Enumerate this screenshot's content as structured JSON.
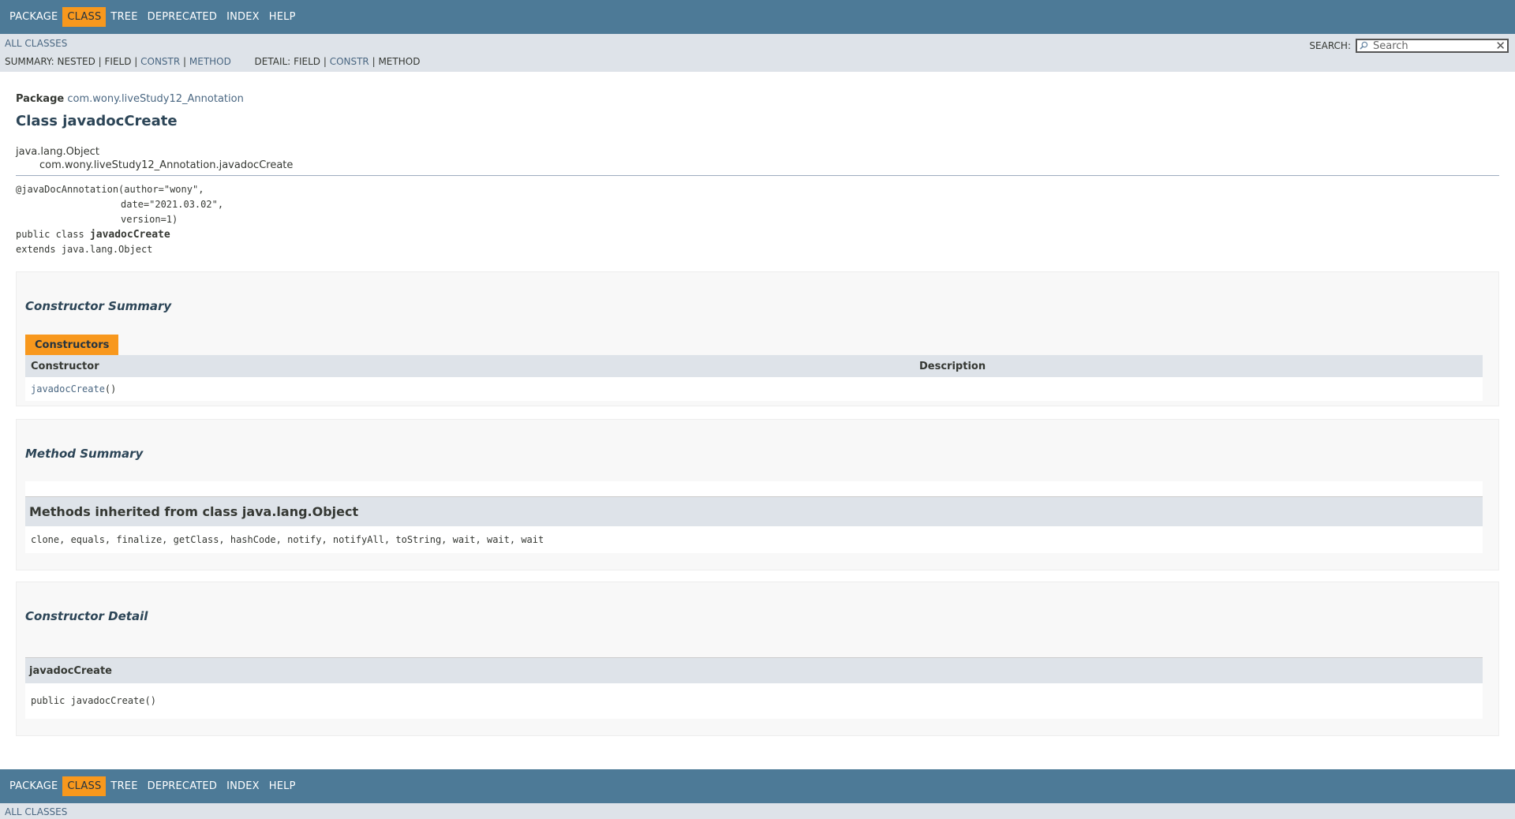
{
  "nav": {
    "items": [
      "PACKAGE",
      "CLASS",
      "TREE",
      "DEPRECATED",
      "INDEX",
      "HELP"
    ],
    "active": "CLASS"
  },
  "subnav": {
    "all_classes": "ALL CLASSES",
    "summary_label": "SUMMARY:",
    "summary_nested": "NESTED",
    "summary_field": "FIELD",
    "summary_constr": "CONSTR",
    "summary_method": "METHOD",
    "detail_label": "DETAIL:",
    "detail_field": "FIELD",
    "detail_constr": "CONSTR",
    "detail_method": "METHOD",
    "separator": " | ",
    "search_label": "SEARCH:",
    "search_placeholder": "Search"
  },
  "header": {
    "package_label": "Package",
    "package_name": "com.wony.liveStudy12_Annotation",
    "class_title": "Class javadocCreate"
  },
  "inheritance": {
    "parent": "java.lang.Object",
    "child": "com.wony.liveStudy12_Annotation.javadocCreate"
  },
  "signature": {
    "annotation_line1": "@javaDocAnnotation(author=\"wony\",",
    "annotation_line2": "date=\"2021.03.02\",",
    "annotation_line3": "version=1)",
    "decl_prefix": "public class ",
    "class_name": "javadocCreate",
    "extends_line": "extends java.lang.Object"
  },
  "constructor_summary": {
    "heading": "Constructor Summary",
    "tab": "Constructors",
    "col_constructor": "Constructor",
    "col_description": "Description",
    "rows": [
      {
        "name": "javadocCreate",
        "params": "()"
      }
    ]
  },
  "method_summary": {
    "heading": "Method Summary",
    "inherited_heading": "Methods inherited from class java.lang.Object",
    "inherited_methods": "clone, equals, finalize, getClass, hashCode, notify, notifyAll, toString, wait, wait, wait"
  },
  "constructor_detail": {
    "heading": "Constructor Detail",
    "name": "javadocCreate",
    "signature": "public javadocCreate()"
  },
  "colors": {
    "nav_bg": "#4d7a97",
    "active_bg": "#f8981d",
    "subnav_bg": "#dee3e9",
    "link": "#4a6782"
  }
}
